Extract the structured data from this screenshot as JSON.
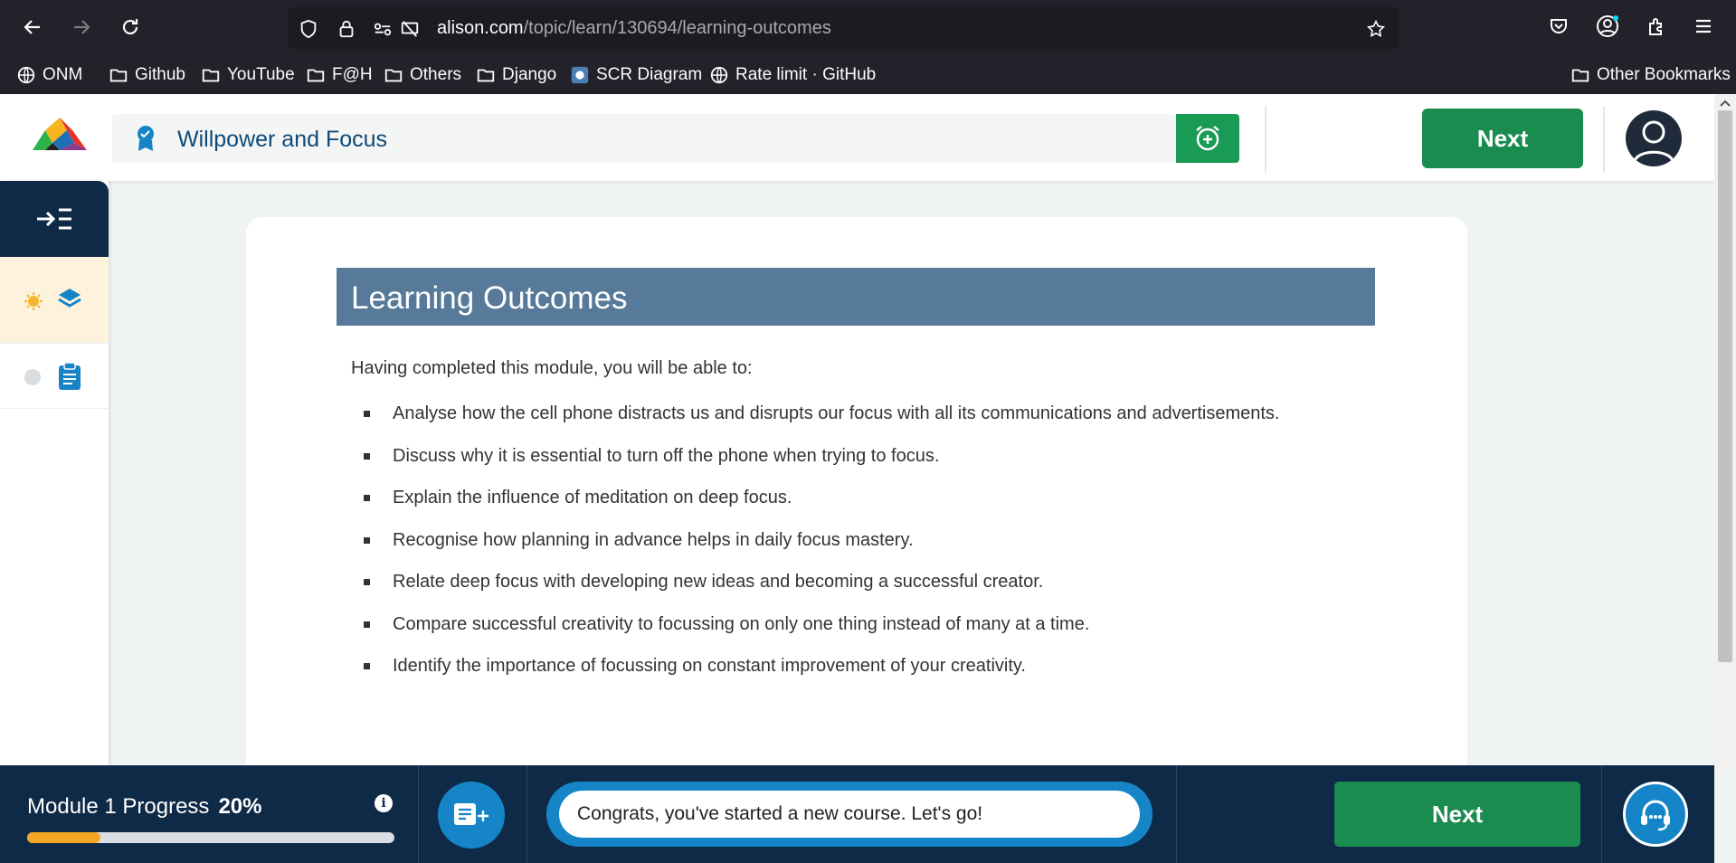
{
  "browser": {
    "url_domain": "alison.com",
    "url_path": "/topic/learn/130694/learning-outcomes",
    "bookmarks": [
      "ONM",
      "Github",
      "YouTube",
      "F@H",
      "Others",
      "Django",
      "SCR Diagram",
      "Rate limit · GitHub"
    ],
    "other_bookmarks": "Other Bookmarks"
  },
  "header": {
    "course_title": "Willpower and Focus",
    "next_label": "Next"
  },
  "content": {
    "heading": "Learning Outcomes",
    "intro": "Having completed this module, you will be able to:",
    "outcomes": [
      "Analyse how the cell phone distracts us and disrupts our focus with all its communications and advertisements.",
      "Discuss why it is essential to turn off the phone when trying to focus.",
      "Explain the influence of meditation on deep focus.",
      "Recognise how planning in advance helps in daily focus mastery.",
      "Relate deep focus with developing new ideas and becoming a successful creator.",
      "Compare successful creativity to focussing on only one thing instead of many at a time.",
      "Identify the importance of focussing on constant improvement of your creativity."
    ]
  },
  "footer": {
    "progress_label": "Module 1 Progress",
    "progress_value": "20%",
    "progress_fraction": 0.2,
    "message": "Congrats, you've started a new course. Let's go!",
    "next_label": "Next"
  },
  "colors": {
    "brand_navy": "#0f2a47",
    "next_green": "#1a8c4f",
    "accent_blue": "#1685c7",
    "heading_bar": "#57799a",
    "progress_orange": "#f5a623"
  }
}
